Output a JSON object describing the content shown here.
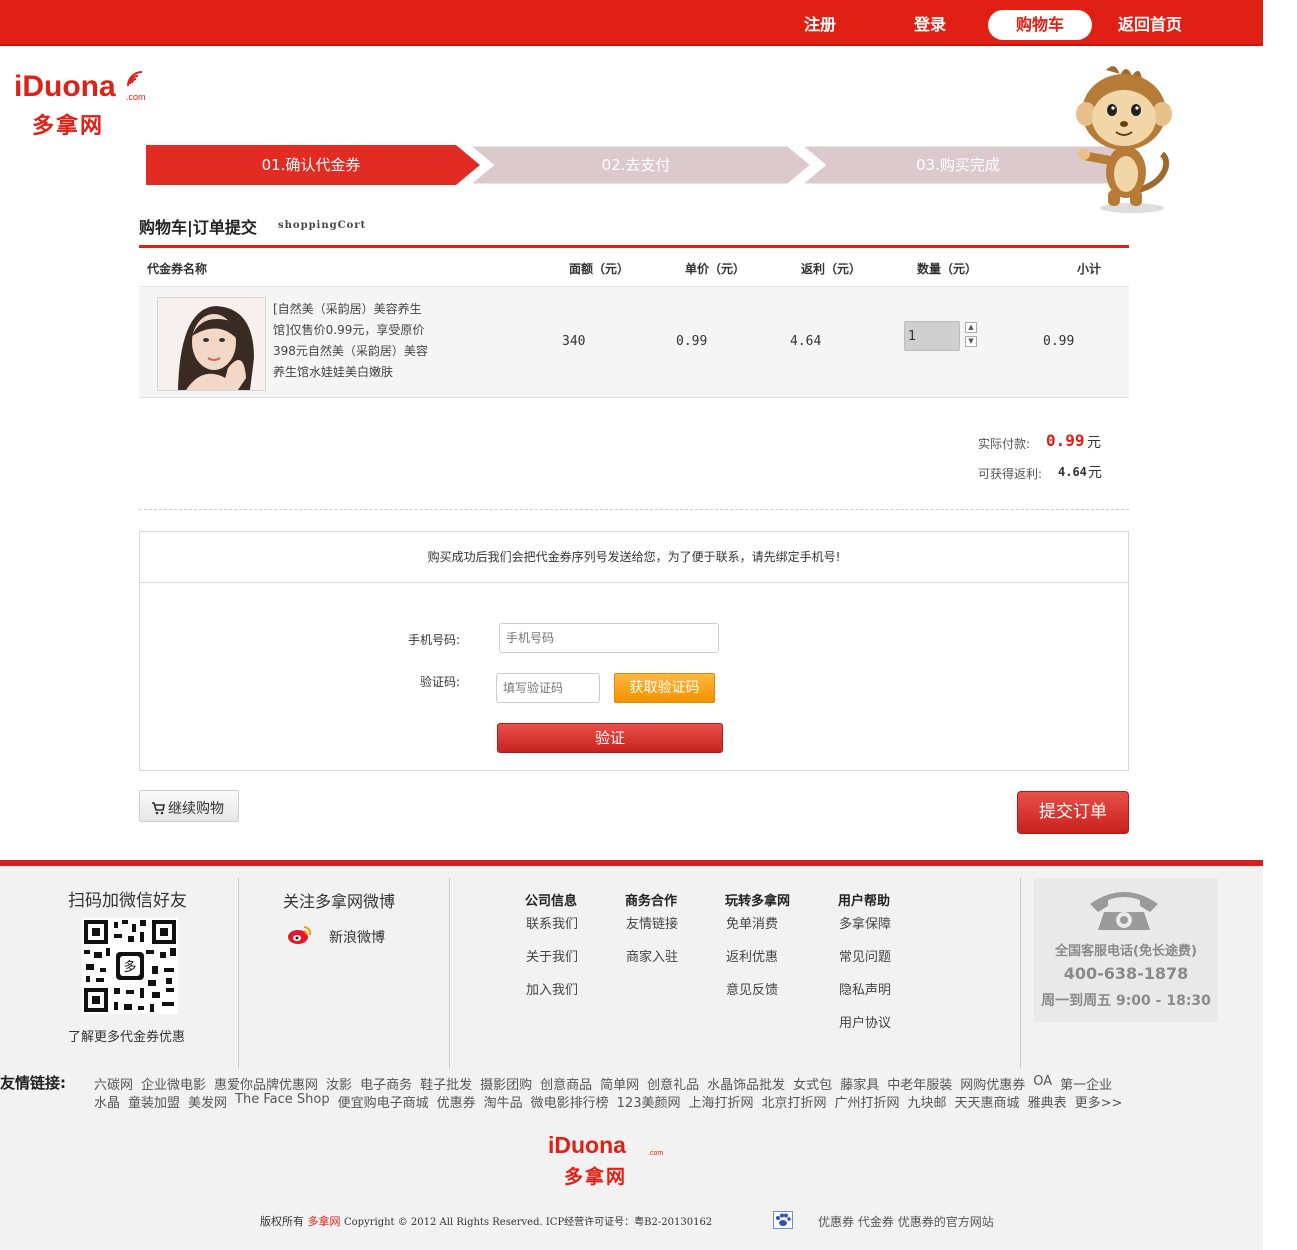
{
  "nav": {
    "items": [
      "注册",
      "登录",
      "购物车",
      "返回首页"
    ],
    "active_index": 2
  },
  "logo": {
    "en": "iDuona",
    "com": ".com",
    "cn": "多拿网"
  },
  "steps": [
    "01.确认代金券",
    "02.去支付",
    "03.购买完成"
  ],
  "cart": {
    "title": "购物车|订单提交",
    "subtitle": "shoppingCort",
    "headers": [
      "代金券名称",
      "面额（元）",
      "单价（元）",
      "返利（元）",
      "数量（元）",
      "小计"
    ],
    "item": {
      "name": "[自然美（采韵居）美容养生馆]仅售价0.99元，享受原价398元自然美（采韵居）美容养生馆水娃娃美白嫩肤",
      "face_value": "340",
      "unit_price": "0.99",
      "rebate": "4.64",
      "quantity": "1",
      "subtotal": "0.99"
    },
    "pay_label": "实际付款:",
    "pay_value": "0.99",
    "pay_unit": "元",
    "rebate_label": "可获得返利:",
    "rebate_value": "4.64",
    "rebate_unit": "元"
  },
  "bind": {
    "notice": "购买成功后我们会把代金券序列号发送给您，为了便于联系，请先绑定手机号!",
    "phone_label": "手机号码:",
    "phone_placeholder": "手机号码",
    "code_label": "验证码:",
    "code_placeholder": "填写验证码",
    "get_code_button": "获取验证码",
    "verify_button": "验证"
  },
  "actions": {
    "continue": "继续购物",
    "submit": "提交订单"
  },
  "footer": {
    "wechat_title": "扫码加微信好友",
    "wechat_more": "了解更多代金券优惠",
    "weibo_title": "关注多拿网微博",
    "weibo_link": "新浪微博",
    "columns": [
      {
        "head": "公司信息",
        "links": [
          "联系我们",
          "关于我们",
          "加入我们"
        ]
      },
      {
        "head": "商务合作",
        "links": [
          "友情链接",
          "商家入驻"
        ]
      },
      {
        "head": "玩转多拿网",
        "links": [
          "免单消费",
          "返利优惠",
          "意见反馈"
        ]
      },
      {
        "head": "用户帮助",
        "links": [
          "多拿保障",
          "常见问题",
          "隐私声明",
          "用户协议"
        ]
      }
    ],
    "service_title": "全国客服电话(免长途费)",
    "service_phone": "400-638-1878",
    "service_hours": "周一到周五 9:00 - 18:30",
    "friend_label": "友情链接:",
    "friend_row1": [
      "六碳网",
      "企业微电影",
      "惠爱你品牌优惠网",
      "汝影",
      "电子商务",
      "鞋子批发",
      "摄影团购",
      "创意商品",
      "简单网",
      "创意礼品",
      "水晶饰品批发",
      "女式包",
      "藤家具",
      "中老年服装",
      "网购优惠券",
      "OA",
      "第一企业"
    ],
    "friend_row2": [
      "水晶",
      "童装加盟",
      "美发网",
      "The Face Shop",
      "便宜购电子商城",
      "优惠券",
      "淘牛品",
      "微电影排行榜",
      "123美颜网",
      "上海打折网",
      "北京打折网",
      "广州打折网",
      "九块邮",
      "天天惠商城",
      "雅典表",
      "更多>>"
    ],
    "copyright_prefix": "版权所有",
    "copyright_brand": "多拿网",
    "copyright_text": "Copyright © 2012 All Rights Reserved. ICP经营许可证号：粤B2-20130162",
    "bottom_links": [
      "优惠券",
      "代金券",
      "优惠券的官方网站"
    ]
  }
}
